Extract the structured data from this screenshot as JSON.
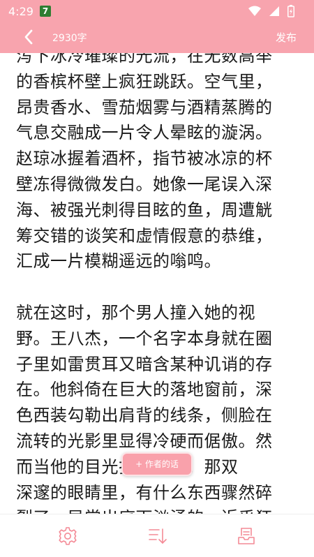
{
  "status": {
    "time": "4:29",
    "notif_badge": "7"
  },
  "header": {
    "title": "2930字",
    "publish_label": "发布"
  },
  "content": {
    "paragraphs": [
      "泻下冰冷璀璨的光流，在无数高举\n的香槟杯壁上疯狂跳跃。空气里，\n昂贵香水、雪茄烟雾与酒精蒸腾的\n气息交融成一片令人晕眩的漩涡。\n赵琼冰握着酒杯，指节被冰凉的杯\n壁冻得微微发白。她像一尾误入深\n海、被强光刺得目眩的鱼，周遭觥\n筹交错的谈笑和虚情假意的恭维，\n汇成一片模糊遥远的嗡鸣。",
      "就在这时，那个男人撞入她的视\n野。王八杰，一个名字本身就在圈\n子里如雷贯耳又暗含某种讥诮的存\n在。他斜倚在巨大的落地窗前，深\n色西装勾勒出肩背的线条，侧脸在\n流转的光影里显得冷硬而倨傲。然\n而当他的目光扫向她时，那双\n深邃的眼睛里，有什么东西骤然碎\n裂了，异常出底下汹涌的，近乎狂"
    ]
  },
  "floating_button": {
    "label": "+ 作者的话"
  },
  "bottom_bar": {
    "icons": [
      "gear-icon",
      "sort-down-icon",
      "publish-tray-icon"
    ]
  },
  "colors": {
    "accent": "#f8a4ae",
    "text": "#1a1a1a",
    "icon": "#f48a96"
  }
}
